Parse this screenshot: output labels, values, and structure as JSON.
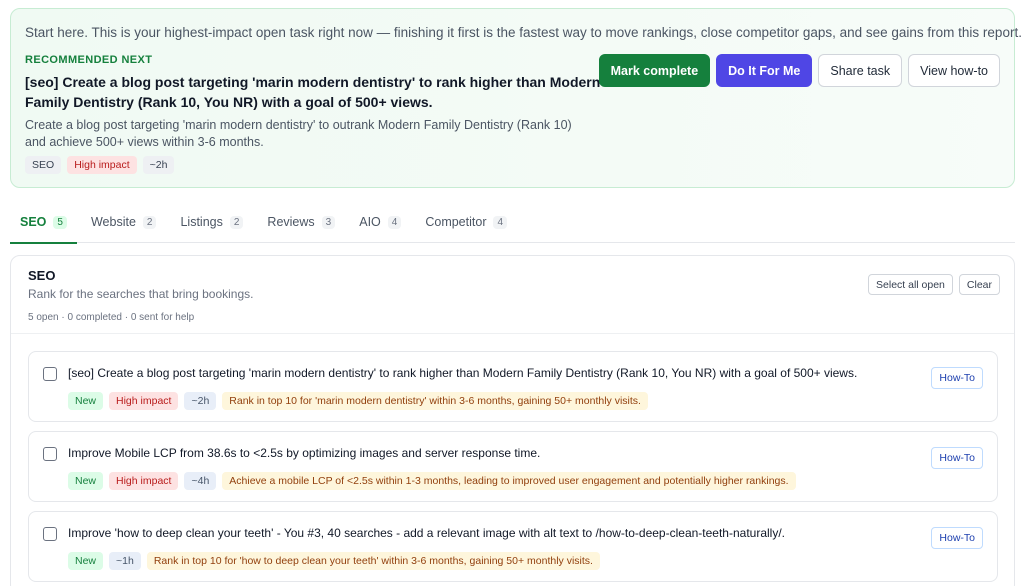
{
  "hero": {
    "intro": "Start here. This is your highest-impact open task right now — finishing it first is the fastest way to move rankings, close competitor gaps, and see gains from this report.",
    "eyebrow": "RECOMMENDED NEXT",
    "title": "[seo] Create a blog post targeting 'marin modern dentistry' to rank higher than Modern Family Dentistry (Rank 10, You NR) with a goal of 500+ views.",
    "description": "Create a blog post targeting 'marin modern dentistry' to outrank Modern Family Dentistry (Rank 10) and achieve 500+ views within 3-6 months.",
    "tags": [
      "SEO",
      "High impact",
      "~2h"
    ],
    "buttons": {
      "mark_complete": "Mark complete",
      "do_it": "Do It For Me",
      "share": "Share task",
      "view_howto": "View how-to"
    }
  },
  "tabs": [
    {
      "label": "SEO",
      "count": "5"
    },
    {
      "label": "Website",
      "count": "2"
    },
    {
      "label": "Listings",
      "count": "2"
    },
    {
      "label": "Reviews",
      "count": "3"
    },
    {
      "label": "AIO",
      "count": "4"
    },
    {
      "label": "Competitor",
      "count": "4"
    }
  ],
  "section": {
    "title": "SEO",
    "subtitle": "Rank for the searches that bring bookings.",
    "meta": "5 open · 0 completed · 0 sent for help",
    "select_all": "Select all open",
    "clear": "Clear"
  },
  "tasks": [
    {
      "title": "[seo] Create a blog post targeting 'marin modern dentistry' to rank higher than Modern Family Dentistry (Rank 10, You NR) with a goal of 500+ views.",
      "status": "New",
      "impact": "High impact",
      "time": "~2h",
      "goal": "Rank in top 10 for 'marin modern dentistry' within 3-6 months, gaining 50+ monthly visits.",
      "howto": "How-To"
    },
    {
      "title": "Improve Mobile LCP from 38.6s to <2.5s by optimizing images and server response time.",
      "status": "New",
      "impact": "High impact",
      "time": "~4h",
      "goal": "Achieve a mobile LCP of <2.5s within 1-3 months, leading to improved user engagement and potentially higher rankings.",
      "howto": "How-To"
    },
    {
      "title": "Improve 'how to deep clean your teeth' - You #3, 40 searches - add a relevant image with alt text to /how-to-deep-clean-teeth-naturally/.",
      "status": "New",
      "time": "~1h",
      "goal": "Rank in top 10 for 'how to deep clean your teeth' within 3-6 months, gaining 50+ monthly visits.",
      "howto": "How-To"
    }
  ],
  "colors": {
    "accent_green": "#15803d",
    "accent_purple": "#4f46e5",
    "impact_red": "#b91c1c"
  }
}
